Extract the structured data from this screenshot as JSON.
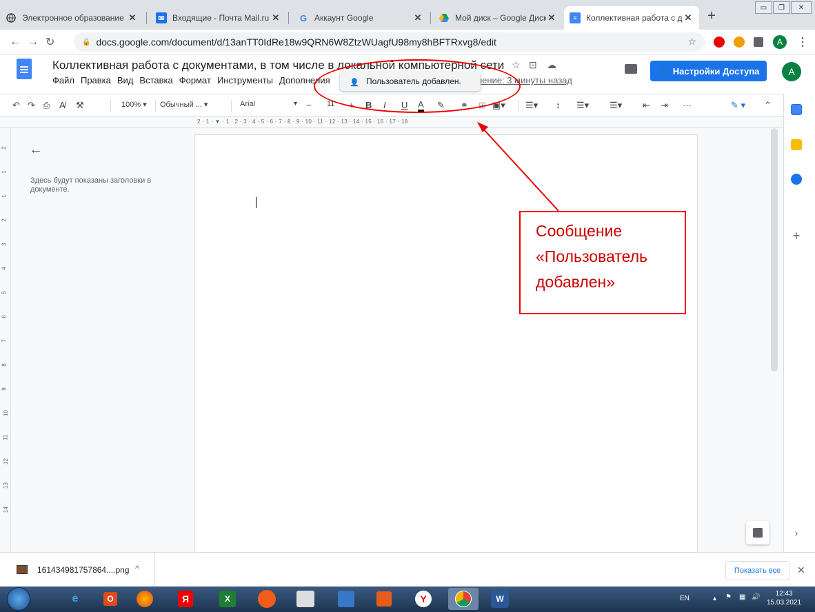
{
  "browser": {
    "tabs": [
      {
        "title": "Электронное образование",
        "icon": "globe-icon",
        "color": "#3c4043"
      },
      {
        "title": "Входящие - Почта Mail.ru",
        "icon": "mail-icon",
        "color": "#1a73e8"
      },
      {
        "title": "Аккаунт Google",
        "icon": "google-g-icon",
        "color": "#4285f4"
      },
      {
        "title": "Мой диск – Google Диск",
        "icon": "drive-icon",
        "color": "#0f9d58"
      },
      {
        "title": "Коллективная работа с доку",
        "icon": "docs-icon",
        "color": "#4285f4"
      }
    ],
    "new_tab": "+",
    "url": "docs.google.com/document/d/13anTT0IdRe18w9QRN6W8ZtzWUagfU98my8hBFTRxvg8/edit",
    "profile_initial": "A"
  },
  "docs": {
    "title": "Коллективная работа с документами,  в том числе в локальной компьютерной сети",
    "menus": [
      "Файл",
      "Правка",
      "Вид",
      "Вставка",
      "Формат",
      "Инструменты",
      "Дополнения"
    ],
    "last_edit": "нение: 3 минуты назад",
    "share_label": "Настройки Доступа",
    "account_initial": "A",
    "toast": "Пользователь добавлен."
  },
  "format_toolbar": {
    "zoom": "100%",
    "style": "Обычный ...",
    "font": "Arial",
    "font_size": "11",
    "bold": "B",
    "italic": "I",
    "underline": "U",
    "text_color": "A",
    "more": "···"
  },
  "ruler": {
    "numbers": "2 · 1 · ▼ · 1 · 2 · 3 · 4 · 5 · 6 · 7 · 8 · 9 · 10 · 11 · 12 · 13 · 14 · 15 · 16 · 17 · 18",
    "vertical": [
      "2",
      "1",
      "1",
      "2",
      "3",
      "4",
      "5",
      "6",
      "7",
      "8",
      "9",
      "10",
      "11",
      "12",
      "13",
      "14"
    ]
  },
  "outline": {
    "placeholder": "Здесь будут показаны заголовки в документе."
  },
  "annotation": {
    "lines": [
      "Сообщение",
      "«Пользователь",
      "добавлен»"
    ],
    "color": "#e00000"
  },
  "downloads": {
    "file": "161434981757864....png",
    "show_all": "Показать все"
  },
  "taskbar": {
    "lang": "EN",
    "time": "12:43",
    "date": "15.03.2021"
  }
}
